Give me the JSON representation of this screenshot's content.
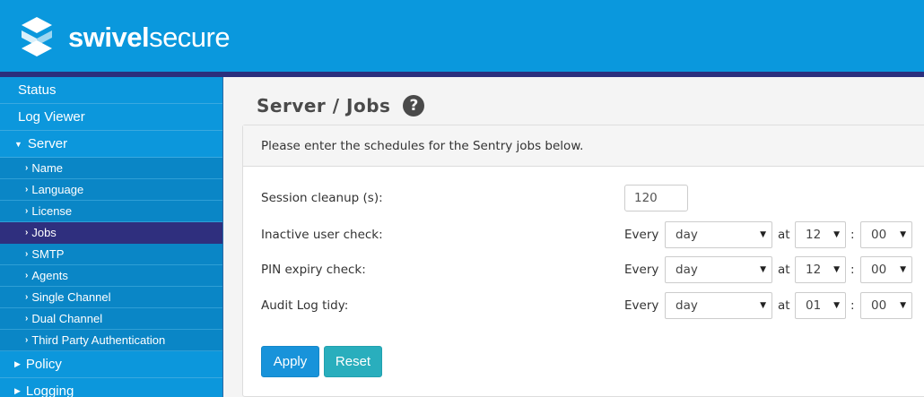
{
  "brand": {
    "name_bold": "swivel",
    "name_rest": "secure",
    "logo": "swivelsecure-logo"
  },
  "sidebar": {
    "items": [
      {
        "label": "Status",
        "level": 1
      },
      {
        "label": "Log Viewer",
        "level": 1
      },
      {
        "label": "Server",
        "level": 1,
        "expanded": true
      },
      {
        "label": "Name",
        "level": 2
      },
      {
        "label": "Language",
        "level": 2
      },
      {
        "label": "License",
        "level": 2
      },
      {
        "label": "Jobs",
        "level": 2,
        "active": true
      },
      {
        "label": "SMTP",
        "level": 2
      },
      {
        "label": "Agents",
        "level": 2
      },
      {
        "label": "Single Channel",
        "level": 2
      },
      {
        "label": "Dual Channel",
        "level": 2
      },
      {
        "label": "Third Party Authentication",
        "level": 2
      },
      {
        "label": "Policy",
        "level": 1
      },
      {
        "label": "Logging",
        "level": 1
      }
    ]
  },
  "page": {
    "title": "Server / Jobs",
    "help_icon": "?",
    "intro": "Please enter the schedules for the Sentry jobs below."
  },
  "form": {
    "session_cleanup": {
      "label": "Session cleanup (s):",
      "value": "120"
    },
    "schedules": [
      {
        "label": "Inactive user check:",
        "every": "Every",
        "period": "day",
        "at": "at",
        "hour": "12",
        "sep": ":",
        "minute": "00"
      },
      {
        "label": "PIN expiry check:",
        "every": "Every",
        "period": "day",
        "at": "at",
        "hour": "12",
        "sep": ":",
        "minute": "00"
      },
      {
        "label": "Audit Log tidy:",
        "every": "Every",
        "period": "day",
        "at": "at",
        "hour": "01",
        "sep": ":",
        "minute": "00"
      }
    ],
    "apply_label": "Apply",
    "reset_label": "Reset"
  },
  "colors": {
    "header": "#0a98dd",
    "header_stripe": "#2b2f7d",
    "sidebar": "#0a8fd1",
    "active_item": "#2f2f7e",
    "apply": "#1893da",
    "reset": "#29aebd"
  }
}
